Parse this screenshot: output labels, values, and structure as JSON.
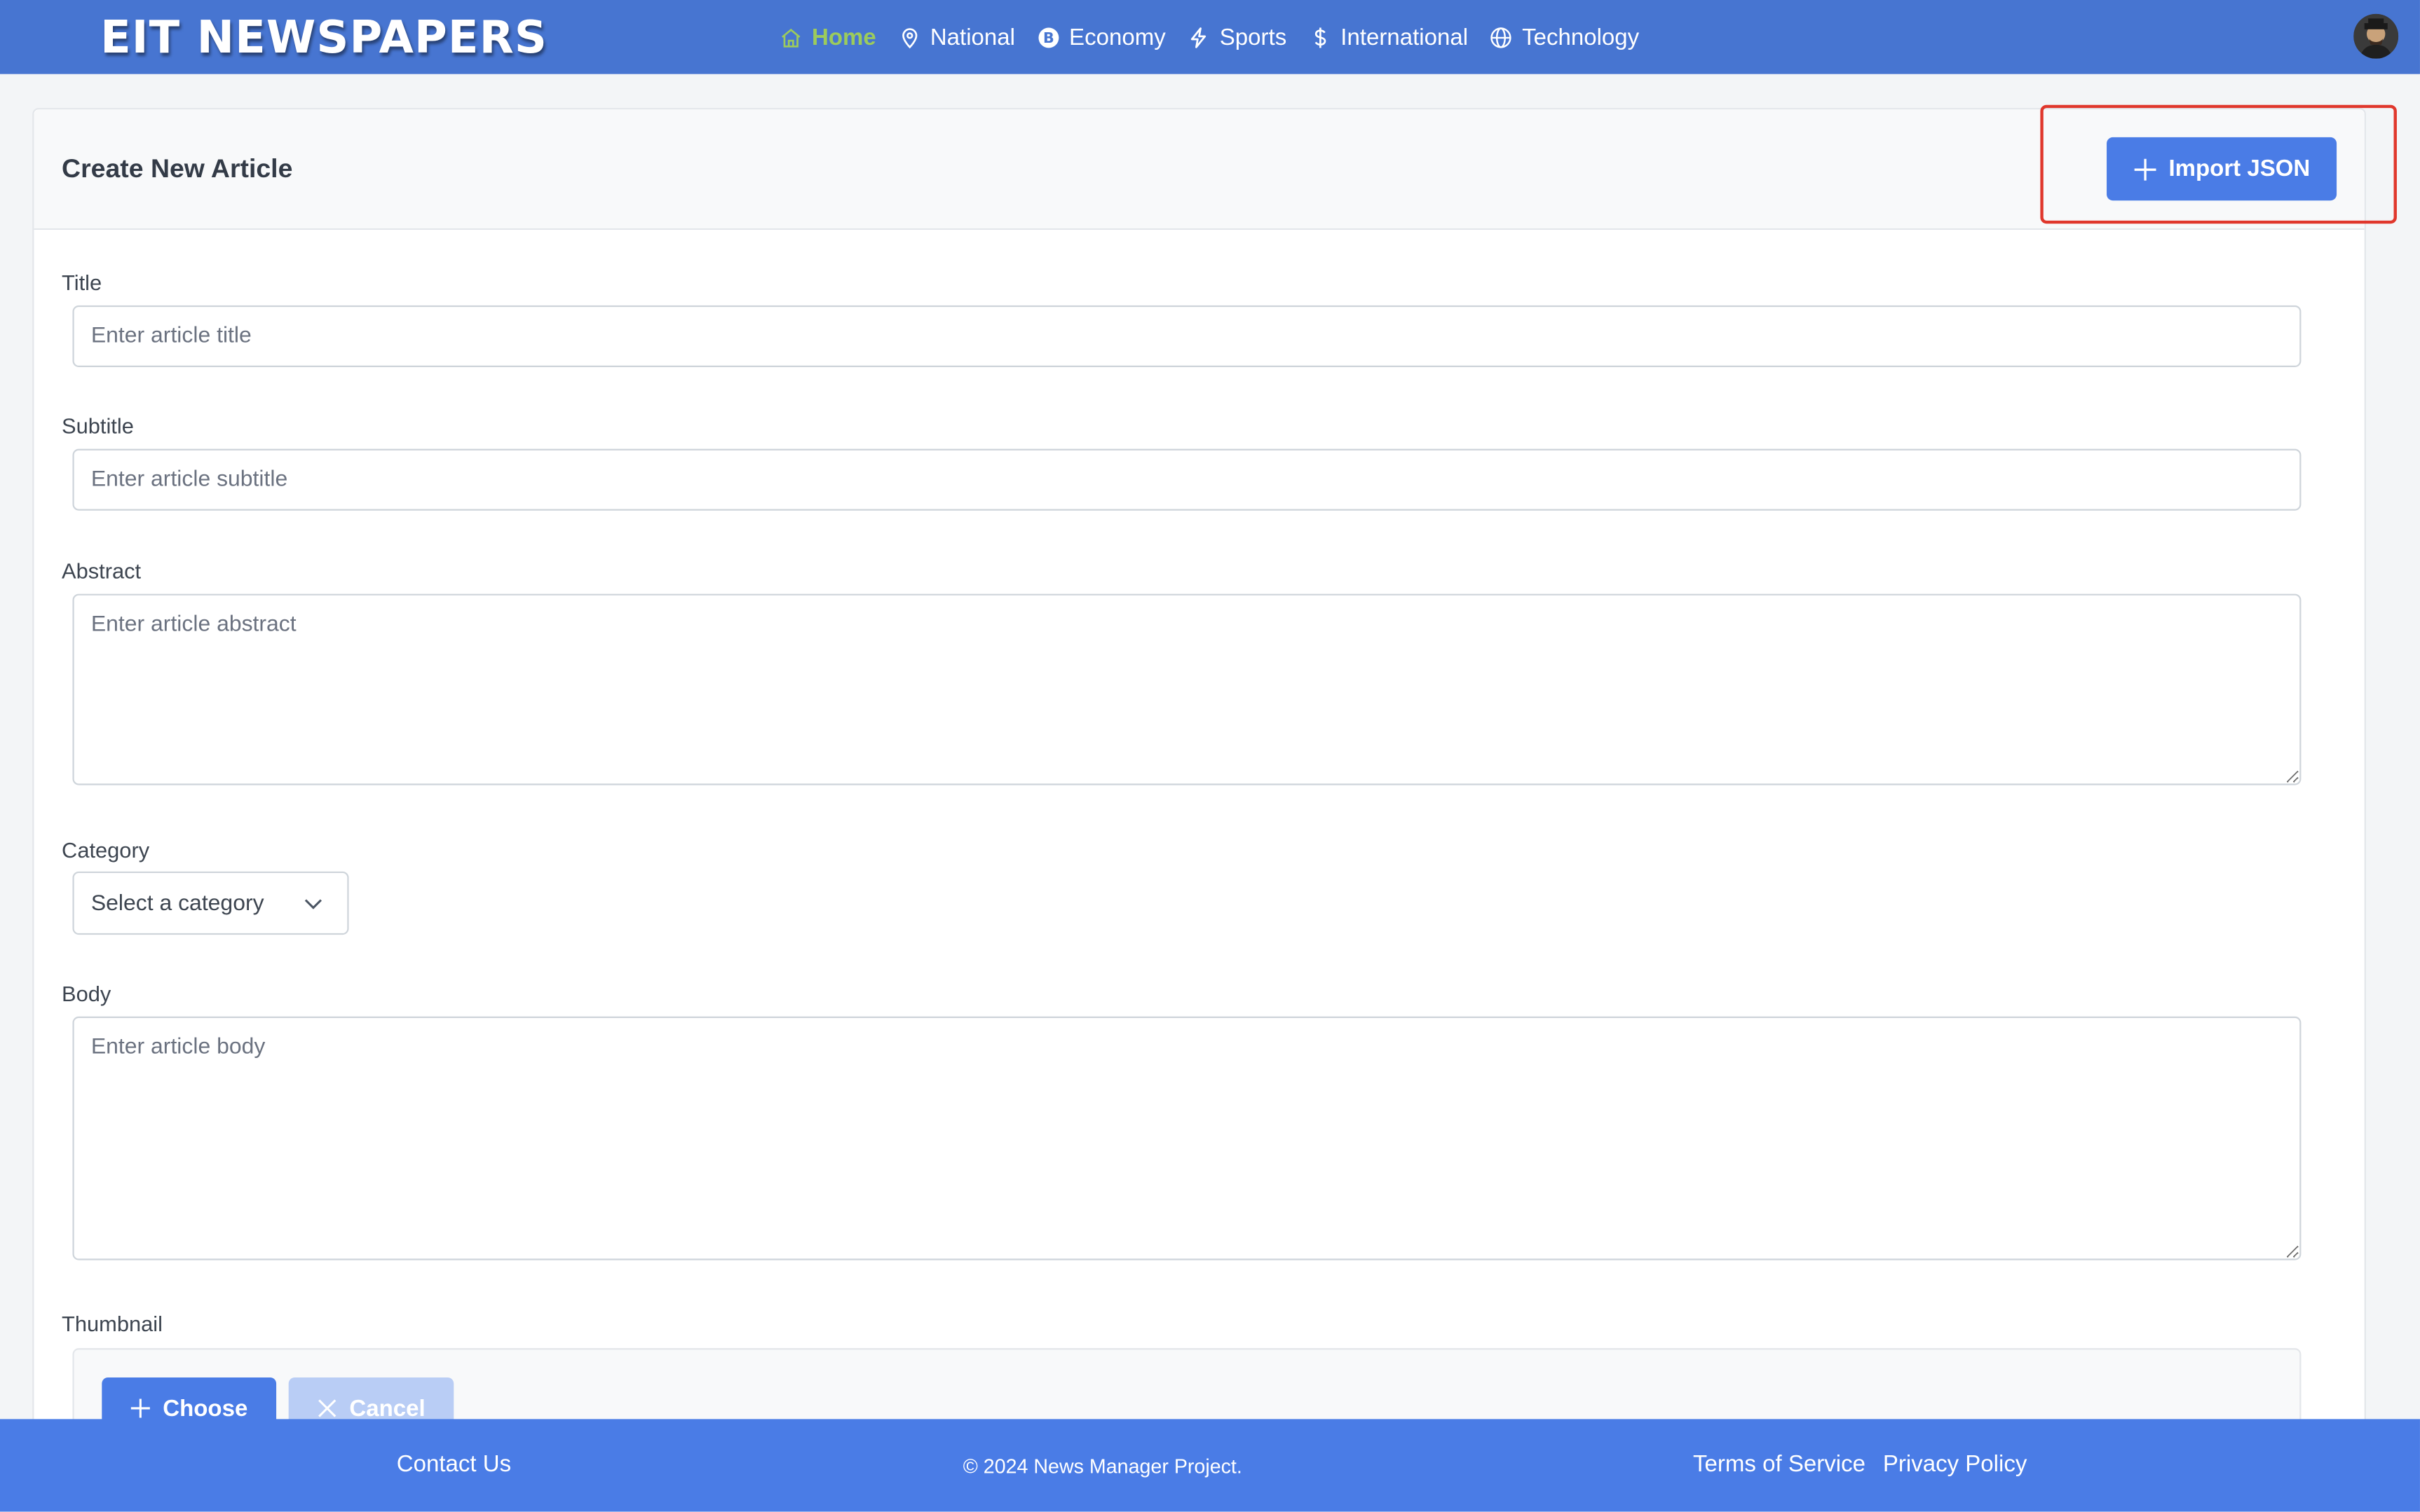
{
  "header": {
    "brand": "EIT NEWSPAPERS",
    "nav": [
      {
        "label": "Home",
        "icon": "home-icon",
        "active": true
      },
      {
        "label": "National",
        "icon": "map-pin-icon"
      },
      {
        "label": "Economy",
        "icon": "bitcoin-icon"
      },
      {
        "label": "Sports",
        "icon": "lightning-icon"
      },
      {
        "label": "International",
        "icon": "dollar-icon"
      },
      {
        "label": "Technology",
        "icon": "globe-icon"
      }
    ]
  },
  "form": {
    "title": "Create New Article",
    "import_label": "Import JSON",
    "fields": {
      "title": {
        "label": "Title",
        "placeholder": "Enter article title",
        "value": ""
      },
      "subtitle": {
        "label": "Subtitle",
        "placeholder": "Enter article subtitle",
        "value": ""
      },
      "abstract": {
        "label": "Abstract",
        "placeholder": "Enter article abstract",
        "value": ""
      },
      "category": {
        "label": "Category",
        "value": "Select a category"
      },
      "body": {
        "label": "Body",
        "placeholder": "Enter article body",
        "value": ""
      },
      "thumbnail": {
        "label": "Thumbnail",
        "choose_label": "Choose",
        "cancel_label": "Cancel"
      }
    }
  },
  "footer": {
    "contact": "Contact Us",
    "copyright": "© 2024 News Manager Project.",
    "terms": "Terms of Service",
    "privacy": "Privacy Policy"
  },
  "colors": {
    "header_bg": "#4775d1",
    "accent": "#4a7ce6",
    "active_nav": "#9ccb5c",
    "highlight": "#e0372c"
  }
}
